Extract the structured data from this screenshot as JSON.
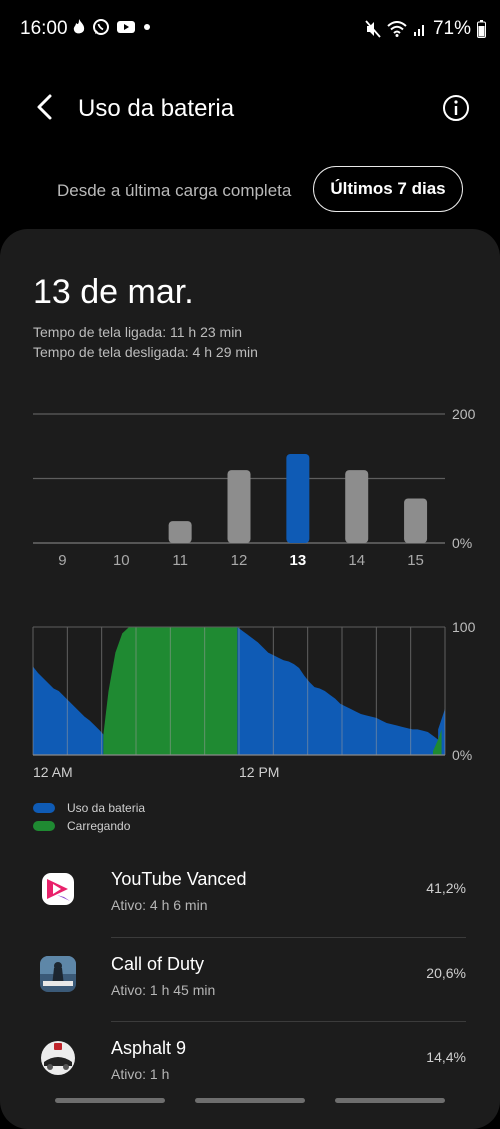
{
  "status_bar": {
    "time": "16:00",
    "battery": "71%",
    "left_icons": [
      "flame-icon",
      "whatsapp-icon",
      "youtube-icon",
      "dot-icon"
    ],
    "right_icons": [
      "mute-icon",
      "wifi-icon",
      "signal-icon",
      "battery-icon"
    ]
  },
  "header": {
    "title": "Uso da bateria"
  },
  "range": {
    "label": "Desde a última carga completa",
    "button": "Últimos 7 dias"
  },
  "card": {
    "day": "13 de mar.",
    "screen_on": "Tempo de tela ligada: 11 h 23 min",
    "screen_off": "Tempo de tela desligada: 4 h 29 min"
  },
  "chart_data": [
    {
      "type": "bar",
      "categories": [
        "9",
        "10",
        "11",
        "12",
        "13",
        "14",
        "15"
      ],
      "values": [
        0,
        0,
        34,
        113,
        138,
        113,
        69
      ],
      "selected": "13",
      "ylim": [
        0,
        200
      ],
      "ytick_labels": [
        "200",
        "0%"
      ],
      "colors": {
        "normal": "#8d8d8d",
        "selected": "#0f5bb5"
      }
    },
    {
      "type": "area",
      "ylim": [
        0,
        100
      ],
      "ytick_labels": [
        "100",
        "0%"
      ],
      "xtick_labels": [
        "12 AM",
        "12 PM"
      ],
      "x_hours": [
        0,
        0.3,
        0.6,
        0.9,
        1.2,
        1.5,
        1.8,
        2.1,
        2.4,
        2.7,
        3,
        3.3,
        3.6,
        3.9,
        4.1,
        4.2,
        4.5,
        4.8,
        5.1,
        5.4,
        5.7,
        6,
        6.3,
        6.6,
        6.9,
        7.2,
        7.5,
        7.8,
        8.1,
        8.4,
        8.7,
        9,
        9.3,
        9.6,
        9.9,
        10.2,
        10.5,
        10.8,
        11.1,
        11.4,
        11.7,
        11.9,
        12.2,
        12.5,
        12.8,
        13.1,
        13.4,
        13.7,
        14,
        14.3,
        14.6,
        14.9,
        15.2,
        15.5,
        15.8,
        16.1,
        16.4,
        16.7,
        17,
        17.3,
        17.6,
        17.9,
        18.2,
        18.5,
        18.8,
        19.1,
        19.4,
        19.7,
        20,
        20.3,
        20.6,
        20.9,
        21.2,
        21.5,
        21.8,
        22.1,
        22.4,
        22.7,
        23,
        23.3,
        23.6,
        23.9,
        24
      ],
      "series": [
        {
          "name": "Uso da bateria",
          "color": "#0f5bb5",
          "segments": [
            {
              "x": [
                0,
                0.3,
                0.6,
                0.9,
                1.2,
                1.5,
                1.8,
                2.1,
                2.4,
                2.7,
                3,
                3.3,
                3.6,
                3.9,
                4.1
              ],
              "y": [
                69,
                64,
                60,
                56,
                52,
                50,
                46,
                42,
                38,
                34,
                30,
                27,
                23,
                19,
                16
              ]
            },
            {
              "x": [
                11.9,
                12.2,
                12.5,
                12.8,
                13.1,
                13.4,
                13.7,
                14,
                14.3,
                14.6,
                14.9,
                15.2,
                15.5,
                15.8,
                16.1,
                16.4,
                16.7,
                17,
                17.3,
                17.6,
                17.9,
                18.2,
                18.5,
                18.8,
                19.1,
                19.4,
                19.7,
                20,
                20.3,
                20.6,
                20.9,
                21.2,
                21.5,
                21.8,
                22.1,
                22.4,
                22.7,
                23,
                23.3,
                23.6
              ],
              "y": [
                100,
                97,
                94,
                91,
                88,
                84,
                80,
                78,
                76,
                74,
                73,
                71,
                68,
                62,
                57,
                53,
                52,
                50,
                47,
                44,
                40,
                38,
                36,
                34,
                32,
                31,
                30,
                29,
                27,
                25,
                24,
                23,
                22,
                21,
                20,
                20,
                19,
                18,
                15,
                12
              ]
            },
            {
              "x": [
                23.6,
                23.8,
                24
              ],
              "y": [
                20,
                28,
                36
              ]
            }
          ]
        },
        {
          "name": "Carregando",
          "color": "#1f8a32",
          "segments": [
            {
              "x": [
                4.1,
                4.4,
                4.8,
                5.2,
                5.6,
                6,
                6.4,
                6.8,
                7.2,
                7.6,
                8,
                8.4,
                8.8,
                9.2,
                9.6,
                10,
                10.4,
                10.8,
                11.2,
                11.6,
                11.9
              ],
              "y": [
                16,
                50,
                80,
                95,
                100,
                100,
                100,
                100,
                100,
                100,
                100,
                100,
                100,
                100,
                100,
                100,
                100,
                100,
                100,
                100,
                100
              ]
            },
            {
              "x": [
                23.3,
                23.6,
                23.8
              ],
              "y": [
                3,
                12,
                20
              ]
            }
          ]
        }
      ]
    }
  ],
  "legend": {
    "usage": "Uso da bateria",
    "charging": "Carregando"
  },
  "apps": [
    {
      "name": "YouTube Vanced",
      "active": "Ativo: 4 h 6 min",
      "percent": "41,2%",
      "icon": "youtube-vanced-icon"
    },
    {
      "name": "Call of Duty",
      "active": "Ativo: 1 h 45 min",
      "percent": "20,6%",
      "icon": "call-of-duty-icon"
    },
    {
      "name": "Asphalt 9",
      "active": "Ativo: 1 h",
      "percent": "14,4%",
      "icon": "asphalt-9-icon"
    }
  ]
}
